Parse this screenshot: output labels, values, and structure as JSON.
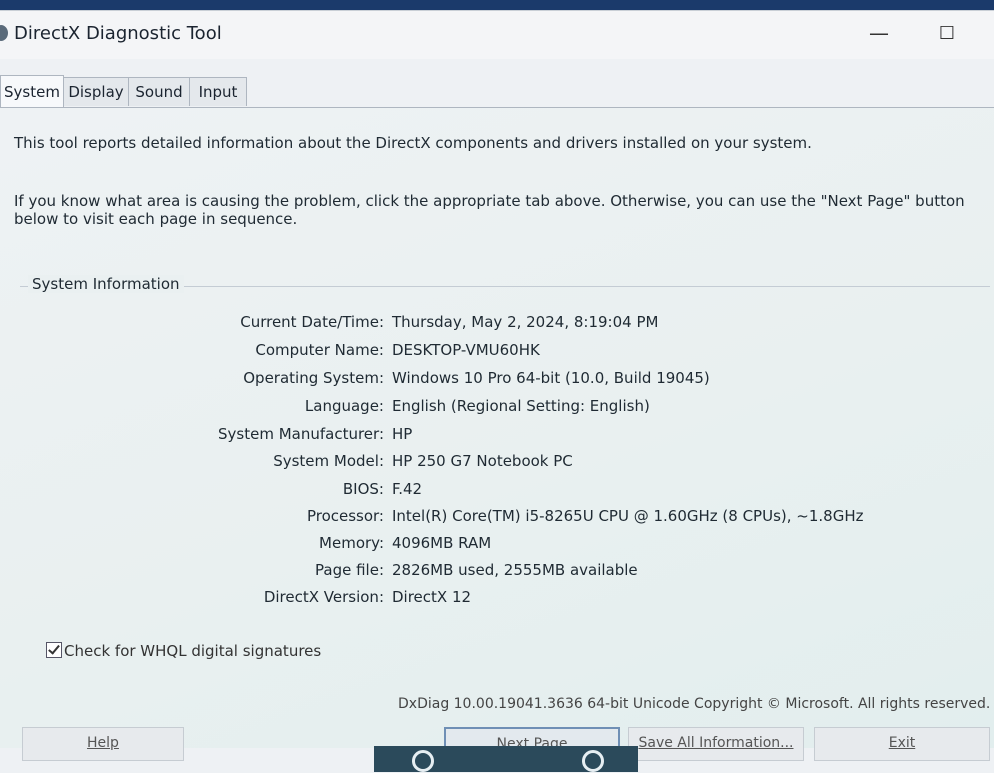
{
  "window": {
    "title": "DirectX Diagnostic Tool",
    "minimize_glyph": "—",
    "maximize_glyph": "☐"
  },
  "tabs": [
    {
      "label": "System",
      "active": true
    },
    {
      "label": "Display",
      "active": false
    },
    {
      "label": "Sound",
      "active": false
    },
    {
      "label": "Input",
      "active": false
    }
  ],
  "intro": {
    "line1": "This tool reports detailed information about the DirectX components and drivers installed on your system.",
    "line2": "If you know what area is causing the problem, click the appropriate tab above.  Otherwise, you can use the \"Next Page\" button below to visit each page in sequence."
  },
  "system_info": {
    "title": "System Information",
    "rows": [
      {
        "label": "Current Date/Time:",
        "value": "Thursday, May 2, 2024, 8:19:04 PM"
      },
      {
        "label": "Computer Name:",
        "value": "DESKTOP-VMU60HK"
      },
      {
        "label": "Operating System:",
        "value": "Windows 10 Pro 64-bit (10.0, Build 19045)"
      },
      {
        "label": "Language:",
        "value": "English (Regional Setting: English)"
      },
      {
        "label": "System Manufacturer:",
        "value": "HP"
      },
      {
        "label": "System Model:",
        "value": "HP 250 G7 Notebook PC"
      },
      {
        "label": "BIOS:",
        "value": "F.42"
      },
      {
        "label": "Processor:",
        "value": "Intel(R) Core(TM) i5-8265U CPU @ 1.60GHz (8 CPUs), ~1.8GHz"
      },
      {
        "label": "Memory:",
        "value": "4096MB RAM"
      },
      {
        "label": "Page file:",
        "value": "2826MB used, 2555MB available"
      },
      {
        "label": "DirectX Version:",
        "value": "DirectX 12"
      }
    ]
  },
  "whql": {
    "label": "Check for WHQL digital signatures",
    "checked": true
  },
  "copyright": "DxDiag 10.00.19041.3636 64-bit Unicode  Copyright © Microsoft. All rights reserved.",
  "buttons": {
    "help": "Help",
    "next_page": "Next Page",
    "save_all": "Save All Information...",
    "exit": "Exit"
  }
}
